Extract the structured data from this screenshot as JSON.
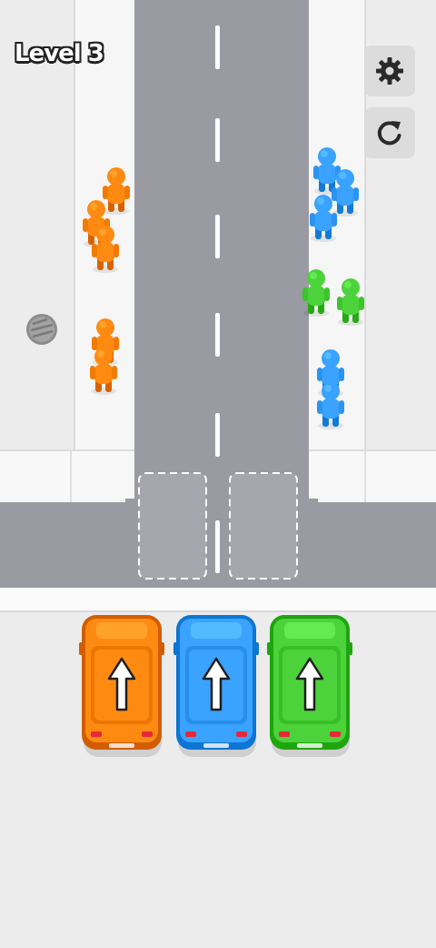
{
  "hud": {
    "level_label": "Level 3",
    "settings_icon": "gear-icon",
    "restart_icon": "restart-icon"
  },
  "colors": {
    "orange": "#ff8a12",
    "blue": "#3aa2ff",
    "green": "#4cd23a",
    "road": "#9a9aa3",
    "sidewalk": "#f6f6f6",
    "background": "#ececec"
  },
  "queues": {
    "left": [
      "orange",
      "orange",
      "orange",
      "orange",
      "orange"
    ],
    "right": [
      "blue",
      "blue",
      "blue",
      "green",
      "green",
      "blue",
      "blue"
    ]
  },
  "parking_slots": [
    {
      "state": "empty"
    },
    {
      "state": "empty"
    }
  ],
  "cars": [
    {
      "color": "orange",
      "direction": "up"
    },
    {
      "color": "blue",
      "direction": "up"
    },
    {
      "color": "green",
      "direction": "up"
    }
  ],
  "manhole_icon": "manhole-cover-icon"
}
